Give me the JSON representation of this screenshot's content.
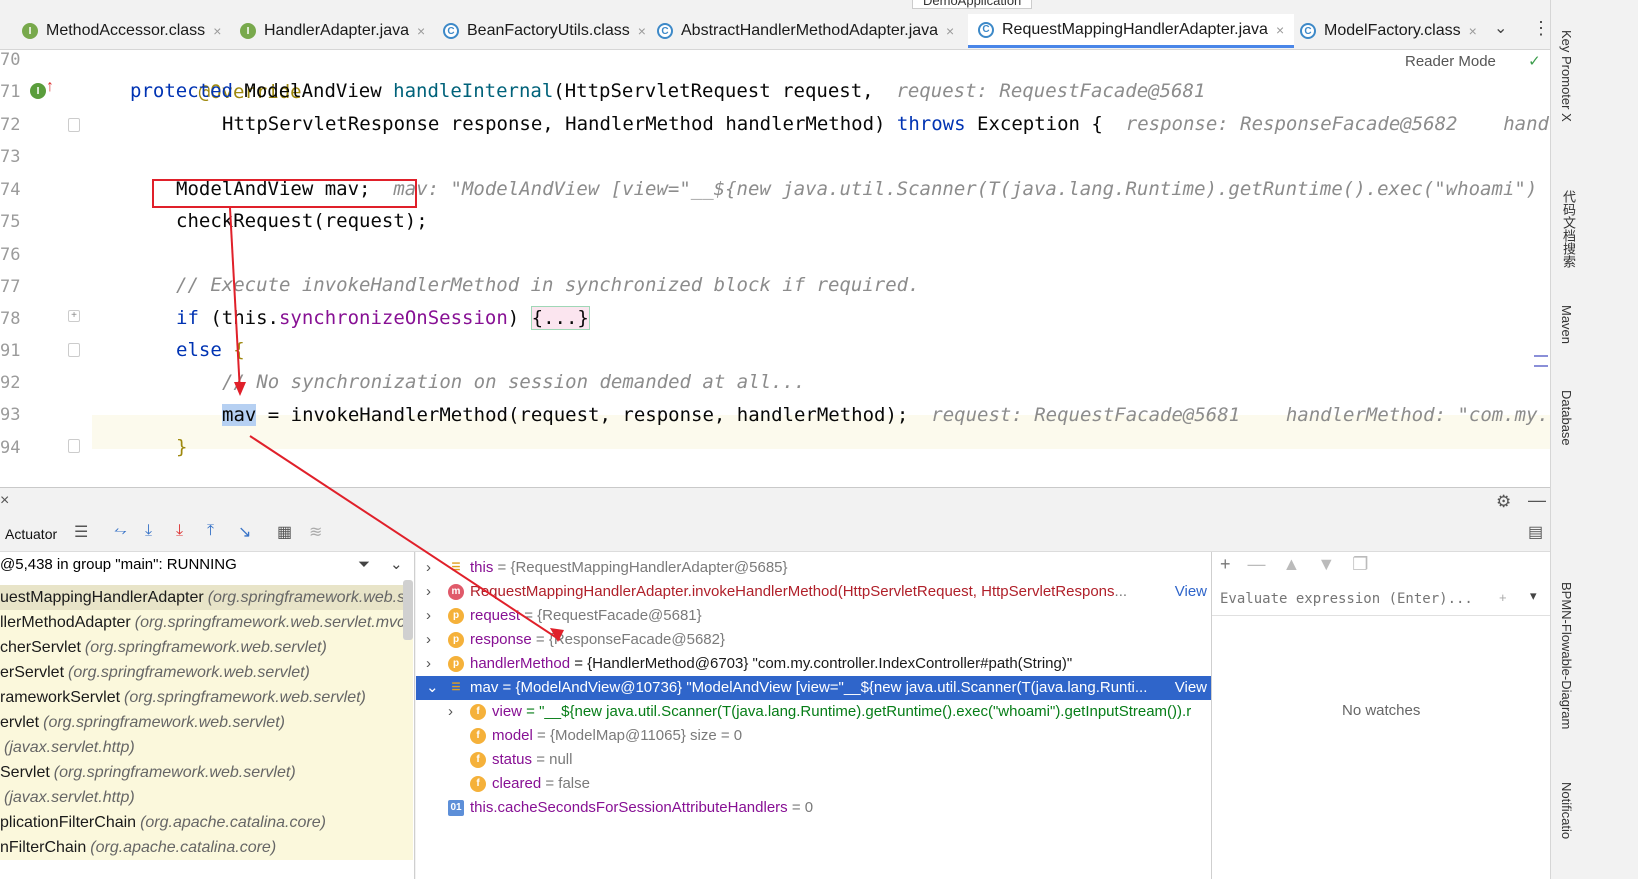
{
  "tabs": [
    {
      "label": "MethodAccessor.class",
      "icon": "I"
    },
    {
      "label": "HandlerAdapter.java",
      "icon": "I"
    },
    {
      "label": "BeanFactoryUtils.class",
      "icon": "C"
    },
    {
      "label": "AbstractHandlerMethodAdapter.java",
      "icon": "C"
    },
    {
      "label": "RequestMappingHandlerAdapter.java",
      "icon": "C"
    },
    {
      "label": "ModelFactory.class",
      "icon": "C"
    }
  ],
  "run_config": "DemoApplication",
  "reader_mode": "Reader Mode",
  "editor": {
    "line_numbers": [
      "70",
      "71",
      "72",
      "73",
      "74",
      "75",
      "76",
      "77",
      "78",
      "91",
      "92",
      "93",
      "94"
    ],
    "l70": "@Override",
    "l71_kw": "protected",
    "l71_type": "ModelAndView",
    "l71_fn": "handleInternal",
    "l71_rest": "(HttpServletRequest request,",
    "l71_hint": "request: RequestFacade@5681",
    "l72_code": "HttpServletResponse response, HandlerMethod handlerMethod)",
    "l72_kw": "throws",
    "l72_rest": "Exception {",
    "l72_hint": "response: ResponseFacade@5682    hand",
    "l74_code": "ModelAndView mav;",
    "l74_hint": "mav: \"ModelAndView [view=\"__${new java.util.Scanner(T(java.lang.Runtime).getRuntime().exec(\"whoami\")",
    "l75_code": "checkRequest(request);",
    "l77_cmt": "// Execute invokeHandlerMethod in synchronized block if required.",
    "l78_kw": "if",
    "l78_a": "(this.",
    "l78_fld": "synchronizeOnSession",
    "l78_b": ")",
    "l78_fold": "{...}",
    "l91_kw": "else",
    "l91_brace": "{",
    "l92_cmt": "// No synchronization on session demanded at all...",
    "l93_var": "mav",
    "l93_code": " = invokeHandlerMethod(request, response, handlerMethod);",
    "l93_hint": "request: RequestFacade@5681    handlerMethod: \"com.my.",
    "l94_code": "}"
  },
  "debug": {
    "tab_label": "Actuator",
    "thread": "@5,438 in group \"main\": RUNNING",
    "frames": [
      {
        "name": "uestMappingHandlerAdapter",
        "pkg": "(org.springframework.web.se"
      },
      {
        "name": "llerMethodAdapter",
        "pkg": "(org.springframework.web.servlet.mvc."
      },
      {
        "name": "cherServlet",
        "pkg": "(org.springframework.web.servlet)"
      },
      {
        "name": "erServlet",
        "pkg": "(org.springframework.web.servlet)"
      },
      {
        "name": "rameworkServlet",
        "pkg": "(org.springframework.web.servlet)"
      },
      {
        "name": "ervlet",
        "pkg": "(org.springframework.web.servlet)"
      },
      {
        "name": "",
        "pkg": "(javax.servlet.http)"
      },
      {
        "name": "Servlet",
        "pkg": "(org.springframework.web.servlet)"
      },
      {
        "name": "",
        "pkg": "(javax.servlet.http)"
      },
      {
        "name": "plicationFilterChain",
        "pkg": "(org.apache.catalina.core)"
      },
      {
        "name": "nFilterChain",
        "pkg": "(org.apache.catalina.core)"
      }
    ],
    "vars": [
      {
        "icon": "=",
        "name": "this",
        "value": " = {RequestMappingHandlerAdapter@5685}",
        "extra": ""
      },
      {
        "icon": "m",
        "name": "RequestMappingHandlerAdapter.invokeHandlerMethod(HttpServletRequest, HttpServletRespons",
        "value": "...",
        "extra": "View"
      },
      {
        "icon": "p",
        "name": "request",
        "value": " = {RequestFacade@5681}",
        "extra": ""
      },
      {
        "icon": "p",
        "name": "response",
        "value": " = {ResponseFacade@5682}",
        "extra": ""
      },
      {
        "icon": "p",
        "name": "handlerMethod",
        "value": " = {HandlerMethod@6703} \"com.my.controller.IndexController#path(String)\"",
        "extra": ""
      },
      {
        "icon": "=",
        "name": "mav",
        "value": " = {ModelAndView@10736} \"ModelAndView [view=\"__${new java.util.Scanner(T(java.lang.Runti...",
        "extra": "View"
      },
      {
        "icon": "f",
        "name": "view",
        "value": " = \"__${new java.util.Scanner(T(java.lang.Runtime).getRuntime().exec(\"whoami\").getInputStream()).r",
        "extra": ""
      },
      {
        "icon": "f",
        "name": "model",
        "value": " = {ModelMap@11065}  size = 0",
        "extra": ""
      },
      {
        "icon": "f",
        "name": "status",
        "value": " = null",
        "extra": ""
      },
      {
        "icon": "f",
        "name": "cleared",
        "value": " = false",
        "extra": ""
      },
      {
        "icon": "01",
        "name": "this.cacheSecondsForSessionAttributeHandlers",
        "value": " = 0",
        "extra": ""
      }
    ],
    "eval_placeholder": "Evaluate expression (Enter)...",
    "no_watches": "No watches"
  },
  "sidebar": {
    "items": [
      "Key Promoter X",
      "代码文档搜索",
      "Maven",
      "Database",
      "BPMN-Flowable-Diagram",
      "Notificatio"
    ]
  },
  "colors": {
    "accent": "#2f65ca",
    "annotation_red": "#e0202a",
    "current_line": "#fcfaed"
  }
}
